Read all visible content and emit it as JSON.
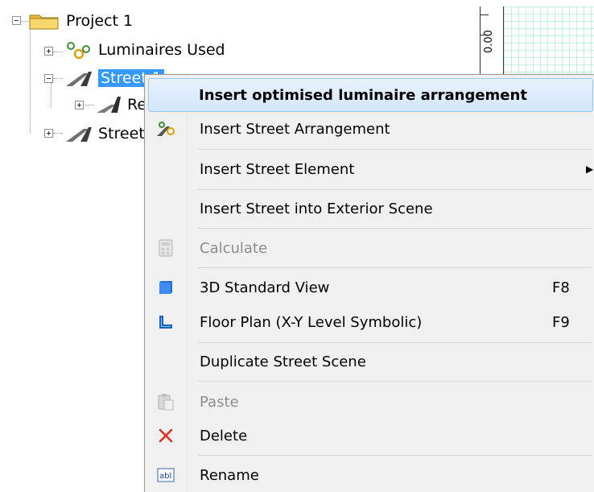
{
  "tree": {
    "root_label": "Project 1",
    "items": [
      {
        "label": "Luminaires Used"
      },
      {
        "label": "Street 1"
      },
      {
        "label": "Re"
      },
      {
        "label": "Street"
      }
    ]
  },
  "panel": {
    "ruler_label": "0.00"
  },
  "context_menu": {
    "items": [
      {
        "label": "Insert optimised luminaire arrangement",
        "mnemonic": "o"
      },
      {
        "label": "Insert Street Arrangement",
        "mnemonic": "A"
      },
      {
        "label": "Insert Street Element",
        "mnemonic": "I"
      },
      {
        "label": "Insert Street into Exterior Scene"
      },
      {
        "label": "Calculate",
        "mnemonic": "c"
      },
      {
        "label": "3D Standard View",
        "shortcut": "F8",
        "mnemonic": "t"
      },
      {
        "label": "Floor Plan (X-Y Level Symbolic)",
        "shortcut": "F9",
        "mnemonic": "F"
      },
      {
        "label": "Duplicate Street Scene",
        "mnemonic": "u"
      },
      {
        "label": "Paste",
        "mnemonic": "P"
      },
      {
        "label": "Delete",
        "mnemonic": "D"
      },
      {
        "label": "Rename",
        "mnemonic": "R"
      }
    ]
  },
  "colors": {
    "selection": "#3399ff",
    "menu_background": "#f0f0f0",
    "hover_highlight": "#d3e6fb",
    "delete_icon": "#e0301e",
    "floorplan_icon": "#1565c0"
  }
}
